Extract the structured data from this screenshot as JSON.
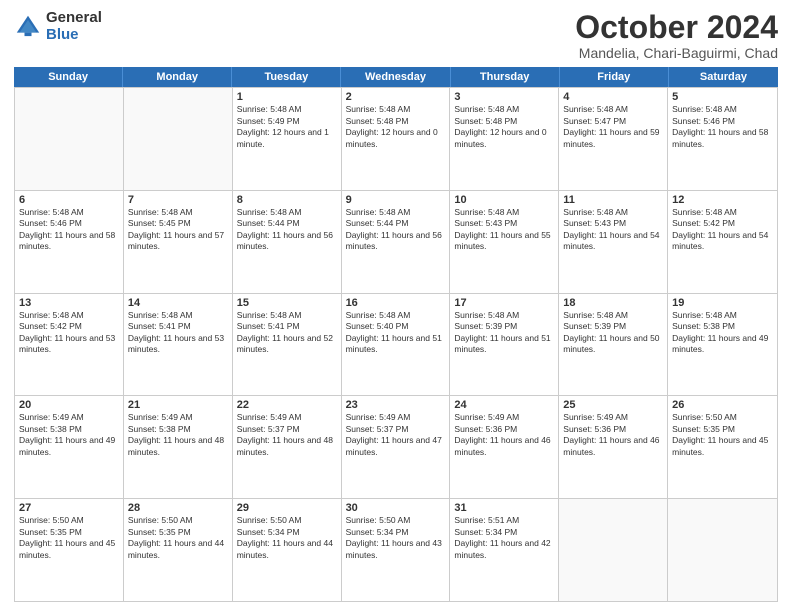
{
  "logo": {
    "general": "General",
    "blue": "Blue"
  },
  "header": {
    "month": "October 2024",
    "location": "Mandelia, Chari-Baguirmi, Chad"
  },
  "weekdays": [
    "Sunday",
    "Monday",
    "Tuesday",
    "Wednesday",
    "Thursday",
    "Friday",
    "Saturday"
  ],
  "weeks": [
    [
      {
        "day": "",
        "sunrise": "",
        "sunset": "",
        "daylight": ""
      },
      {
        "day": "",
        "sunrise": "",
        "sunset": "",
        "daylight": ""
      },
      {
        "day": "1",
        "sunrise": "Sunrise: 5:48 AM",
        "sunset": "Sunset: 5:49 PM",
        "daylight": "Daylight: 12 hours and 1 minute."
      },
      {
        "day": "2",
        "sunrise": "Sunrise: 5:48 AM",
        "sunset": "Sunset: 5:48 PM",
        "daylight": "Daylight: 12 hours and 0 minutes."
      },
      {
        "day": "3",
        "sunrise": "Sunrise: 5:48 AM",
        "sunset": "Sunset: 5:48 PM",
        "daylight": "Daylight: 12 hours and 0 minutes."
      },
      {
        "day": "4",
        "sunrise": "Sunrise: 5:48 AM",
        "sunset": "Sunset: 5:47 PM",
        "daylight": "Daylight: 11 hours and 59 minutes."
      },
      {
        "day": "5",
        "sunrise": "Sunrise: 5:48 AM",
        "sunset": "Sunset: 5:46 PM",
        "daylight": "Daylight: 11 hours and 58 minutes."
      }
    ],
    [
      {
        "day": "6",
        "sunrise": "Sunrise: 5:48 AM",
        "sunset": "Sunset: 5:46 PM",
        "daylight": "Daylight: 11 hours and 58 minutes."
      },
      {
        "day": "7",
        "sunrise": "Sunrise: 5:48 AM",
        "sunset": "Sunset: 5:45 PM",
        "daylight": "Daylight: 11 hours and 57 minutes."
      },
      {
        "day": "8",
        "sunrise": "Sunrise: 5:48 AM",
        "sunset": "Sunset: 5:44 PM",
        "daylight": "Daylight: 11 hours and 56 minutes."
      },
      {
        "day": "9",
        "sunrise": "Sunrise: 5:48 AM",
        "sunset": "Sunset: 5:44 PM",
        "daylight": "Daylight: 11 hours and 56 minutes."
      },
      {
        "day": "10",
        "sunrise": "Sunrise: 5:48 AM",
        "sunset": "Sunset: 5:43 PM",
        "daylight": "Daylight: 11 hours and 55 minutes."
      },
      {
        "day": "11",
        "sunrise": "Sunrise: 5:48 AM",
        "sunset": "Sunset: 5:43 PM",
        "daylight": "Daylight: 11 hours and 54 minutes."
      },
      {
        "day": "12",
        "sunrise": "Sunrise: 5:48 AM",
        "sunset": "Sunset: 5:42 PM",
        "daylight": "Daylight: 11 hours and 54 minutes."
      }
    ],
    [
      {
        "day": "13",
        "sunrise": "Sunrise: 5:48 AM",
        "sunset": "Sunset: 5:42 PM",
        "daylight": "Daylight: 11 hours and 53 minutes."
      },
      {
        "day": "14",
        "sunrise": "Sunrise: 5:48 AM",
        "sunset": "Sunset: 5:41 PM",
        "daylight": "Daylight: 11 hours and 53 minutes."
      },
      {
        "day": "15",
        "sunrise": "Sunrise: 5:48 AM",
        "sunset": "Sunset: 5:41 PM",
        "daylight": "Daylight: 11 hours and 52 minutes."
      },
      {
        "day": "16",
        "sunrise": "Sunrise: 5:48 AM",
        "sunset": "Sunset: 5:40 PM",
        "daylight": "Daylight: 11 hours and 51 minutes."
      },
      {
        "day": "17",
        "sunrise": "Sunrise: 5:48 AM",
        "sunset": "Sunset: 5:39 PM",
        "daylight": "Daylight: 11 hours and 51 minutes."
      },
      {
        "day": "18",
        "sunrise": "Sunrise: 5:48 AM",
        "sunset": "Sunset: 5:39 PM",
        "daylight": "Daylight: 11 hours and 50 minutes."
      },
      {
        "day": "19",
        "sunrise": "Sunrise: 5:48 AM",
        "sunset": "Sunset: 5:38 PM",
        "daylight": "Daylight: 11 hours and 49 minutes."
      }
    ],
    [
      {
        "day": "20",
        "sunrise": "Sunrise: 5:49 AM",
        "sunset": "Sunset: 5:38 PM",
        "daylight": "Daylight: 11 hours and 49 minutes."
      },
      {
        "day": "21",
        "sunrise": "Sunrise: 5:49 AM",
        "sunset": "Sunset: 5:38 PM",
        "daylight": "Daylight: 11 hours and 48 minutes."
      },
      {
        "day": "22",
        "sunrise": "Sunrise: 5:49 AM",
        "sunset": "Sunset: 5:37 PM",
        "daylight": "Daylight: 11 hours and 48 minutes."
      },
      {
        "day": "23",
        "sunrise": "Sunrise: 5:49 AM",
        "sunset": "Sunset: 5:37 PM",
        "daylight": "Daylight: 11 hours and 47 minutes."
      },
      {
        "day": "24",
        "sunrise": "Sunrise: 5:49 AM",
        "sunset": "Sunset: 5:36 PM",
        "daylight": "Daylight: 11 hours and 46 minutes."
      },
      {
        "day": "25",
        "sunrise": "Sunrise: 5:49 AM",
        "sunset": "Sunset: 5:36 PM",
        "daylight": "Daylight: 11 hours and 46 minutes."
      },
      {
        "day": "26",
        "sunrise": "Sunrise: 5:50 AM",
        "sunset": "Sunset: 5:35 PM",
        "daylight": "Daylight: 11 hours and 45 minutes."
      }
    ],
    [
      {
        "day": "27",
        "sunrise": "Sunrise: 5:50 AM",
        "sunset": "Sunset: 5:35 PM",
        "daylight": "Daylight: 11 hours and 45 minutes."
      },
      {
        "day": "28",
        "sunrise": "Sunrise: 5:50 AM",
        "sunset": "Sunset: 5:35 PM",
        "daylight": "Daylight: 11 hours and 44 minutes."
      },
      {
        "day": "29",
        "sunrise": "Sunrise: 5:50 AM",
        "sunset": "Sunset: 5:34 PM",
        "daylight": "Daylight: 11 hours and 44 minutes."
      },
      {
        "day": "30",
        "sunrise": "Sunrise: 5:50 AM",
        "sunset": "Sunset: 5:34 PM",
        "daylight": "Daylight: 11 hours and 43 minutes."
      },
      {
        "day": "31",
        "sunrise": "Sunrise: 5:51 AM",
        "sunset": "Sunset: 5:34 PM",
        "daylight": "Daylight: 11 hours and 42 minutes."
      },
      {
        "day": "",
        "sunrise": "",
        "sunset": "",
        "daylight": ""
      },
      {
        "day": "",
        "sunrise": "",
        "sunset": "",
        "daylight": ""
      }
    ]
  ]
}
